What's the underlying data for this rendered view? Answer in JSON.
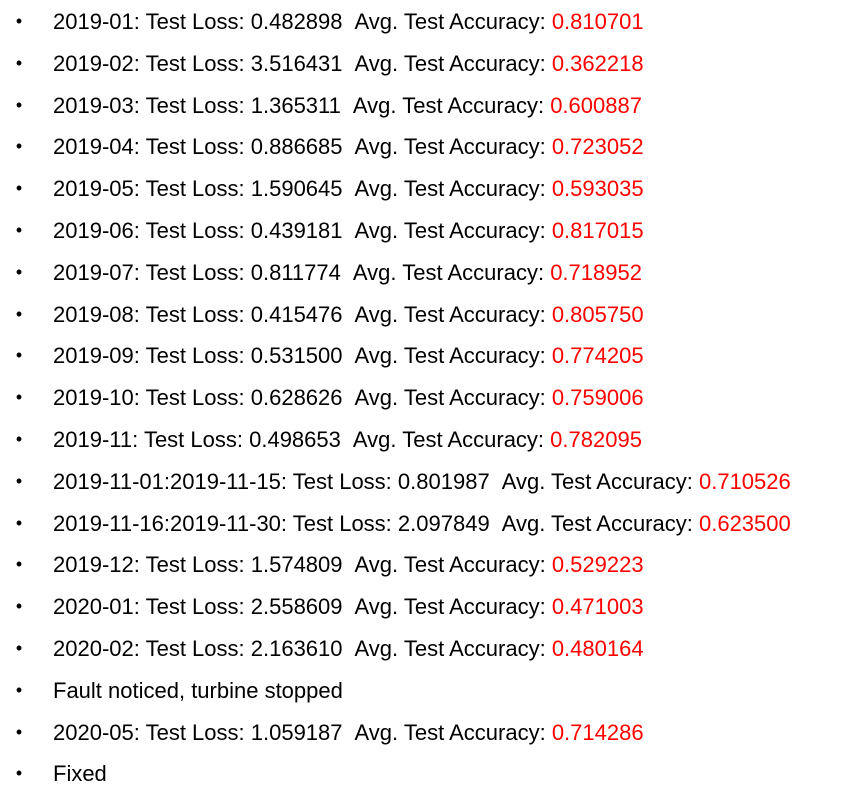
{
  "bullet_glyph": "•",
  "loss_label": "Test Loss:",
  "accuracy_label": "Avg. Test Accuracy:",
  "accuracy_color": "#ff0000",
  "items": [
    {
      "period": "2019-01:",
      "loss": "0.482898",
      "accuracy": "0.810701"
    },
    {
      "period": "2019-02:",
      "loss": "3.516431",
      "accuracy": "0.362218"
    },
    {
      "period": "2019-03:",
      "loss": "1.365311",
      "accuracy": "0.600887"
    },
    {
      "period": "2019-04:",
      "loss": "0.886685",
      "accuracy": "0.723052"
    },
    {
      "period": "2019-05:",
      "loss": "1.590645",
      "accuracy": "0.593035"
    },
    {
      "period": "2019-06:",
      "loss": "0.439181",
      "accuracy": "0.817015"
    },
    {
      "period": "2019-07:",
      "loss": "0.811774",
      "accuracy": "0.718952"
    },
    {
      "period": "2019-08:",
      "loss": "0.415476",
      "accuracy": "0.805750"
    },
    {
      "period": "2019-09:",
      "loss": "0.531500",
      "accuracy": "0.774205"
    },
    {
      "period": "2019-10:",
      "loss": "0.628626",
      "accuracy": "0.759006"
    },
    {
      "period": "2019-11:",
      "loss": "0.498653",
      "accuracy": "0.782095"
    },
    {
      "period": "2019-11-01:2019-11-15:",
      "loss": "0.801987",
      "accuracy": "0.710526"
    },
    {
      "period": "2019-11-16:2019-11-30:",
      "loss": "2.097849",
      "accuracy": "0.623500"
    },
    {
      "period": "2019-12:",
      "loss": "1.574809",
      "accuracy": "0.529223"
    },
    {
      "period": "2020-01:",
      "loss": "2.558609",
      "accuracy": "0.471003"
    },
    {
      "period": "2020-02:",
      "loss": "2.163610",
      "accuracy": "0.480164"
    },
    {
      "note": "Fault noticed, turbine stopped"
    },
    {
      "period": "2020-05:",
      "loss": "1.059187",
      "accuracy": "0.714286"
    },
    {
      "note": "Fixed"
    }
  ]
}
